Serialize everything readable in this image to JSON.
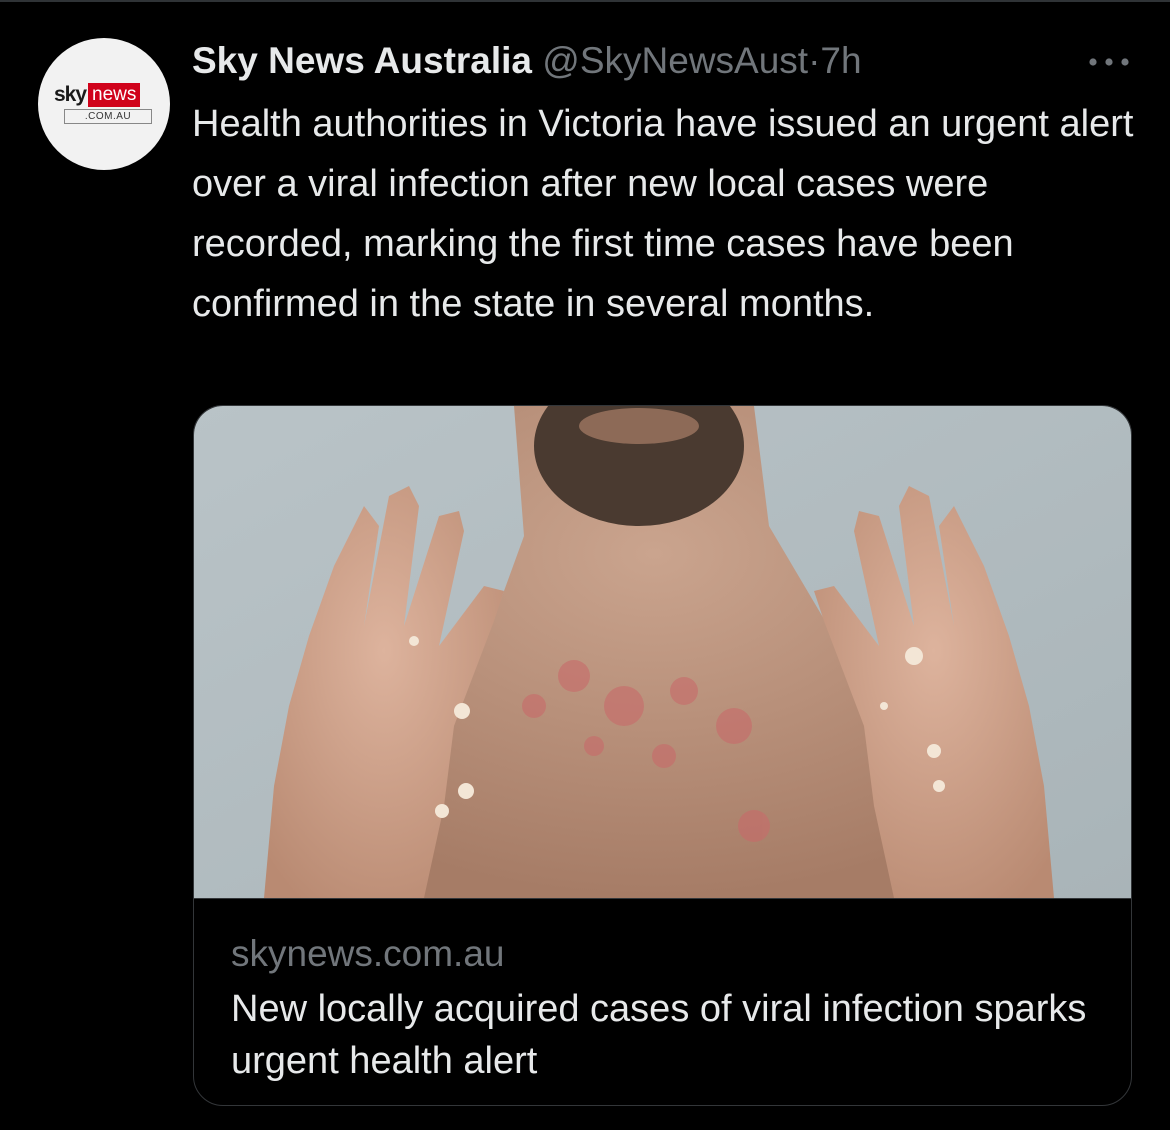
{
  "tweet": {
    "author": {
      "display_name": "Sky News Australia",
      "handle": "@SkyNewsAust",
      "separator": "·",
      "time": "7h",
      "avatar_logo": {
        "sky": "sky",
        "news": "news",
        "domain": ".COM.AU"
      }
    },
    "more_icon": "more-horizontal-icon",
    "text": "Health authorities in Victoria have issued an urgent alert over a viral infection after new local cases were recorded, marking the first time cases have been confirmed in the state in several months.",
    "card": {
      "domain": "skynews.com.au",
      "title": "New locally acquired cases of viral infection sparks urgent health alert"
    }
  },
  "colors": {
    "background": "#000000",
    "text_primary": "#e7e9ea",
    "text_secondary": "#71767b",
    "border": "#333639",
    "sky_news_red": "#d0021b"
  }
}
